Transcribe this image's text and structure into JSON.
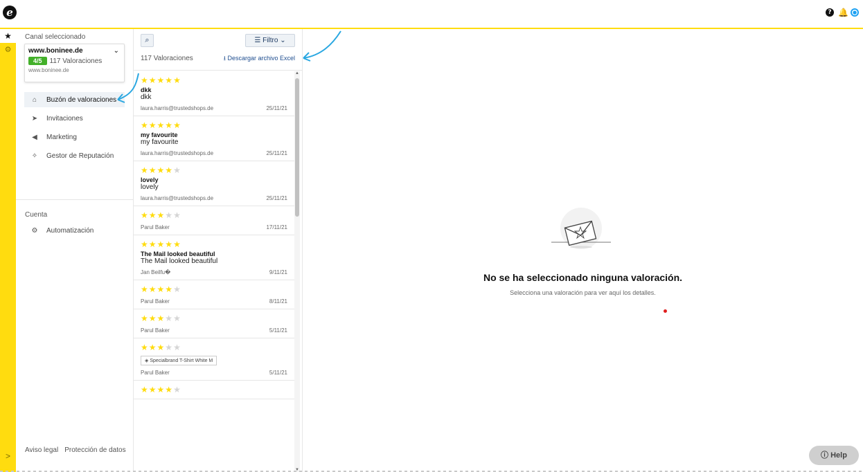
{
  "app": {
    "logo_glyph": "e",
    "top_icons": [
      "help-icon",
      "bell-icon",
      "user-icon"
    ]
  },
  "rail": {
    "items": [
      "star-icon",
      "gear-icon"
    ],
    "expand": ">"
  },
  "sidebar": {
    "channel_section_label": "Canal seleccionado",
    "channel": {
      "name": "www.boninee.de",
      "score": "4/5",
      "count": "117 Valoraciones",
      "url": "www.boninee.de"
    },
    "items": [
      {
        "label": "Buzón de valoraciones",
        "icon": "inbox-icon",
        "glyph": "⌂"
      },
      {
        "label": "Invitaciones",
        "icon": "send-icon",
        "glyph": "➤"
      },
      {
        "label": "Marketing",
        "icon": "megaphone-icon",
        "glyph": "◀"
      },
      {
        "label": "Gestor de Reputación",
        "icon": "sparkle-icon",
        "glyph": "✧"
      }
    ],
    "account_label": "Cuenta",
    "account_items": [
      {
        "label": "Automatización",
        "icon": "automation-icon",
        "glyph": "⚙"
      }
    ],
    "footer": {
      "legal": "Aviso legal",
      "privacy": "Protección de datos"
    }
  },
  "list": {
    "search_icon": "⌕",
    "filter_label": "Filtro",
    "count_label": "117 Valoraciones",
    "excel_label": "Descargar archivo Excel",
    "reviews": [
      {
        "stars": 5,
        "title": "dkk",
        "text": "dkk",
        "author": "laura.harris@trustedshops.de",
        "date": "25/11/21"
      },
      {
        "stars": 5,
        "title": "my favourite",
        "text": "my favourite",
        "author": "laura.harris@trustedshops.de",
        "date": "25/11/21"
      },
      {
        "stars": 4,
        "title": "lovely",
        "text": "lovely",
        "author": "laura.harris@trustedshops.de",
        "date": "25/11/21"
      },
      {
        "stars": 3,
        "title": "",
        "text": "",
        "author": "Parul Baker",
        "date": "17/11/21"
      },
      {
        "stars": 5,
        "title": "The Mail looked beautiful",
        "text": "The Mail looked beautiful",
        "author": "Jan Beilfu�",
        "date": "9/11/21"
      },
      {
        "stars": 4,
        "title": "",
        "text": "",
        "author": "Parul Baker",
        "date": "8/11/21"
      },
      {
        "stars": 3,
        "title": "",
        "text": "",
        "author": "Parul Baker",
        "date": "5/11/21"
      },
      {
        "stars": 3,
        "title": "",
        "text": "",
        "product": "Specialbrand T-Shirt White M",
        "author": "Parul Baker",
        "date": "5/11/21"
      },
      {
        "stars": 4,
        "title": "",
        "text": "",
        "author": "",
        "date": ""
      }
    ]
  },
  "detail": {
    "empty_title": "No se ha seleccionado ninguna valoración.",
    "empty_subtitle": "Selecciona una valoración para ver aquí los detalles."
  },
  "help": {
    "label": "Help"
  },
  "colors": {
    "brand_yellow": "#ffdc0f",
    "score_green": "#43b02a",
    "link_blue": "#1e4d8f",
    "annotation_blue": "#29a7e1"
  }
}
